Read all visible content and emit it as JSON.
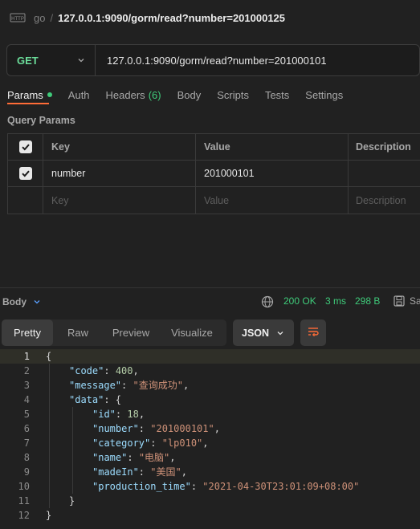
{
  "request": {
    "method_icon_label": "HTTP",
    "collection": "go",
    "title": "127.0.0.1:9090/gorm/read?number=201000125",
    "method": "GET",
    "url": "127.0.0.1:9090/gorm/read?number=201000101"
  },
  "tabs": [
    {
      "label": "Params",
      "active": true,
      "dot": true
    },
    {
      "label": "Auth"
    },
    {
      "label": "Headers",
      "count": "(6)"
    },
    {
      "label": "Body"
    },
    {
      "label": "Scripts"
    },
    {
      "label": "Tests"
    },
    {
      "label": "Settings"
    }
  ],
  "query_params": {
    "label": "Query Params",
    "headers": {
      "key": "Key",
      "value": "Value",
      "description": "Description"
    },
    "rows": [
      {
        "checked": true,
        "key": "number",
        "value": "201000101",
        "description": ""
      }
    ],
    "placeholder": {
      "key": "Key",
      "value": "Value",
      "description": "Description"
    }
  },
  "response": {
    "body_label": "Body",
    "status": "200 OK",
    "time": "3 ms",
    "size": "298 B",
    "save_label": "Sa",
    "views": [
      "Pretty",
      "Raw",
      "Preview",
      "Visualize"
    ],
    "active_view": "Pretty",
    "format": "JSON",
    "lines": [
      {
        "n": "1",
        "parts": [
          [
            "p",
            "{"
          ]
        ]
      },
      {
        "n": "2",
        "parts": [
          [
            "k",
            "\"code\""
          ],
          [
            "p",
            ": "
          ],
          [
            "n",
            "400"
          ],
          [
            "p",
            ","
          ]
        ]
      },
      {
        "n": "3",
        "parts": [
          [
            "k",
            "\"message\""
          ],
          [
            "p",
            ": "
          ],
          [
            "s",
            "\"查询成功\""
          ],
          [
            "p",
            ","
          ]
        ]
      },
      {
        "n": "4",
        "parts": [
          [
            "k",
            "\"data\""
          ],
          [
            "p",
            ": {"
          ]
        ]
      },
      {
        "n": "5",
        "parts": [
          [
            "k",
            "\"id\""
          ],
          [
            "p",
            ": "
          ],
          [
            "n",
            "18"
          ],
          [
            "p",
            ","
          ]
        ]
      },
      {
        "n": "6",
        "parts": [
          [
            "k",
            "\"number\""
          ],
          [
            "p",
            ": "
          ],
          [
            "s",
            "\"201000101\""
          ],
          [
            "p",
            ","
          ]
        ]
      },
      {
        "n": "7",
        "parts": [
          [
            "k",
            "\"category\""
          ],
          [
            "p",
            ": "
          ],
          [
            "s",
            "\"lp010\""
          ],
          [
            "p",
            ","
          ]
        ]
      },
      {
        "n": "8",
        "parts": [
          [
            "k",
            "\"name\""
          ],
          [
            "p",
            ": "
          ],
          [
            "s",
            "\"电脑\""
          ],
          [
            "p",
            ","
          ]
        ]
      },
      {
        "n": "9",
        "parts": [
          [
            "k",
            "\"madeIn\""
          ],
          [
            "p",
            ": "
          ],
          [
            "s",
            "\"美国\""
          ],
          [
            "p",
            ","
          ]
        ]
      },
      {
        "n": "10",
        "parts": [
          [
            "k",
            "\"production_time\""
          ],
          [
            "p",
            ": "
          ],
          [
            "s",
            "\"2021-04-30T23:01:09+08:00\""
          ]
        ]
      },
      {
        "n": "11",
        "parts": [
          [
            "p",
            "}"
          ]
        ]
      },
      {
        "n": "12",
        "parts": [
          [
            "p",
            "}"
          ]
        ]
      }
    ]
  },
  "colors": {
    "accent": "#ff6c37",
    "success": "#3fcb7a",
    "method_get": "#6bdd9a",
    "json_key": "#9cdcfe",
    "json_string": "#ce9178",
    "json_number": "#b5cea8"
  }
}
